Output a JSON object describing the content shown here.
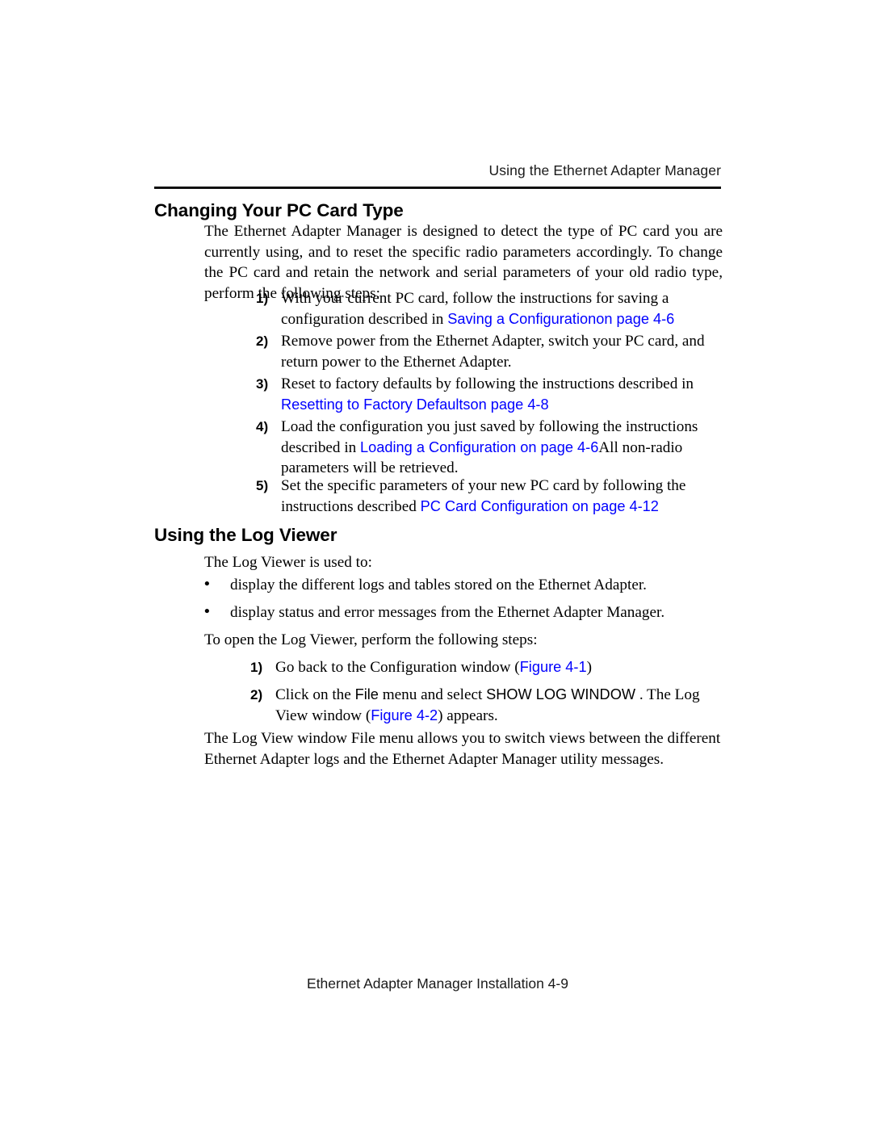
{
  "header": {
    "running_head": "Using the Ethernet Adapter Manager"
  },
  "sections": [
    {
      "heading": "Changing Your PC Card Type",
      "intro": "The Ethernet Adapter Manager is designed to detect the type of PC card you are currently using, and to reset the specific radio parameters accordingly. To change the PC card and retain the network and serial parameters of your old radio type, perform the following steps:",
      "steps": [
        {
          "marker": "1)",
          "before": "With your current PC card, follow the instructions for saving a configuration described in ",
          "link": "Saving a Configurationon page 4-6",
          "after": ""
        },
        {
          "marker": "2)",
          "before": "Remove power from the Ethernet Adapter, switch your PC card, and return power to the Ethernet Adapter.",
          "link": "",
          "after": ""
        },
        {
          "marker": "3)",
          "before": "Reset to factory defaults by following the instructions described in ",
          "link": "Resetting to Factory Defaultson page 4-8",
          "after": ""
        },
        {
          "marker": "4)",
          "before": "Load the configuration you just saved by following the instructions described in ",
          "link": "Loading a Configuration on page 4-6",
          "after": "All non-radio parameters will be retrieved."
        },
        {
          "marker": "5)",
          "before": "Set the specific parameters of your new PC card by following the instructions described ",
          "link": "PC Card Configuration on page 4-12",
          "after": ""
        }
      ]
    },
    {
      "heading": "Using the Log Viewer",
      "intro": "The Log Viewer is used to:",
      "bullets": [
        {
          "marker": "•",
          "text": "display the different logs and tables stored on the Ethernet Adapter."
        },
        {
          "marker": "•",
          "text": "display status and error messages from the Ethernet Adapter Manager."
        }
      ],
      "lead_in": "To open the Log Viewer, perform the following steps:",
      "steps": [
        {
          "marker": "1)",
          "part1": "Go back to the Configuration window (",
          "link1": "Figure 4-1",
          "part2": ")",
          "ui1": "",
          "part3": "",
          "ui2": "",
          "part4": "",
          "link2": "",
          "part5": ""
        },
        {
          "marker": "2)",
          "part1": "Click on the ",
          "ui1": "File",
          "part2": " menu and select ",
          "ui2": "SHOW LOG WINDOW",
          "part3": " . The Log View window (",
          "link2": "Figure 4-2",
          "part4": ") appears.",
          "link1": "",
          "part5": ""
        }
      ],
      "closing": "The Log View window File menu allows you to switch views between the different Ethernet Adapter logs and the Ethernet Adapter Manager utility messages."
    }
  ],
  "footer": {
    "text": "Ethernet Adapter Manager Installation 4-9"
  },
  "colors": {
    "xref_blue": "#0000ff",
    "body_black": "#000000",
    "rule": "#111111"
  }
}
